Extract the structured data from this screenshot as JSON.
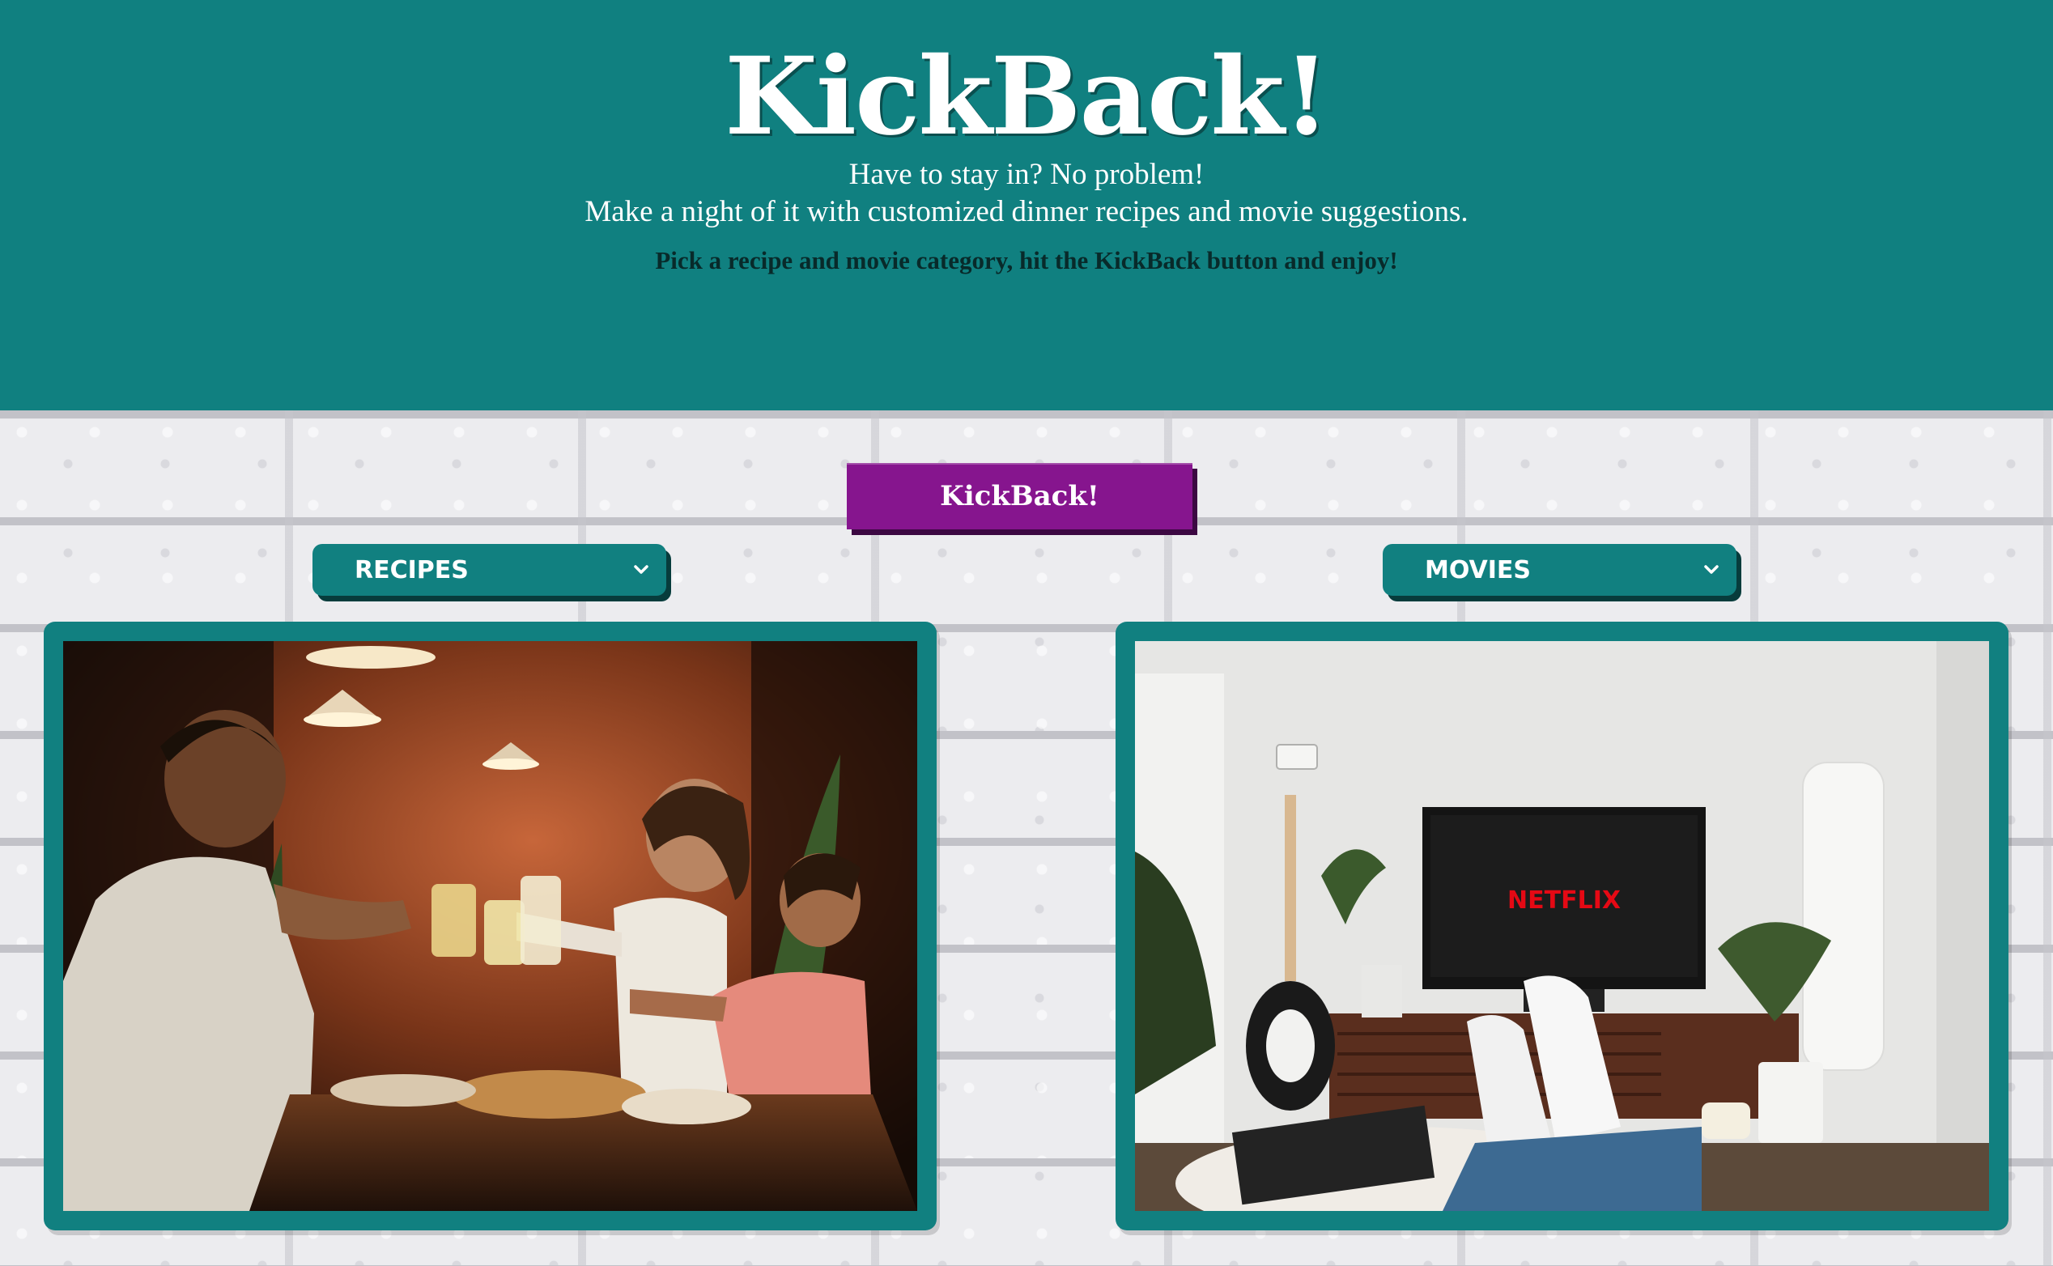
{
  "header": {
    "title": "KickBack!",
    "tagline_line1": "Have to stay in? No problem!",
    "tagline_line2": "Make a night of it with customized dinner recipes and movie suggestions.",
    "instructions": "Pick a recipe and movie category, hit the KickBack button and enjoy!"
  },
  "kickback_button": {
    "label": "KickBack!"
  },
  "recipes_select": {
    "selected": "RECIPES",
    "icon": "chevron-down-icon"
  },
  "movies_select": {
    "selected": "MOVIES",
    "icon": "chevron-down-icon"
  },
  "tv_screen": {
    "text": "NETFLIX"
  },
  "colors": {
    "header_bg": "#108080",
    "button_purple": "#86158e",
    "select_teal": "#118080",
    "netflix_red": "#e50914"
  }
}
